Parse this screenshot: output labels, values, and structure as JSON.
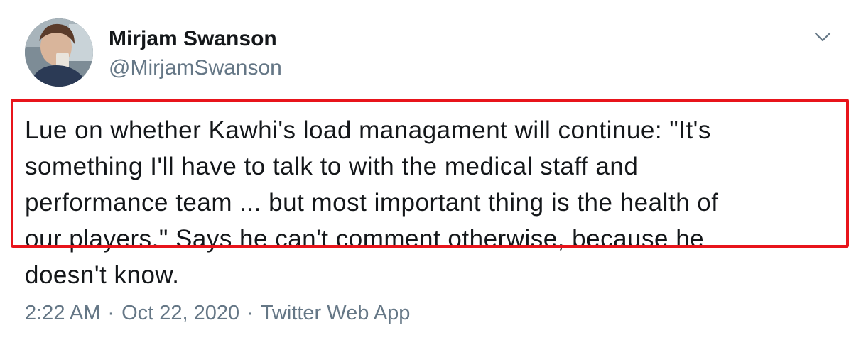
{
  "author": {
    "display_name": "Mirjam Swanson",
    "handle": "@MirjamSwanson"
  },
  "tweet": {
    "text_lines": [
      "Lue on whether Kawhi's load managament will continue: \"It's",
      "something I'll have to talk to with the medical staff and",
      "performance team ... but most important thing is the health of",
      "our players.\" Says he can't comment otherwise, because he",
      "doesn't know."
    ],
    "time": "2:22 AM",
    "date": "Oct 22, 2020",
    "separator": "·",
    "source": "Twitter Web App"
  },
  "icons": {
    "menu": "chevron-down-icon"
  },
  "colors": {
    "highlight_border": "#e8141b",
    "text_primary": "#14171a",
    "text_secondary": "#657786"
  }
}
